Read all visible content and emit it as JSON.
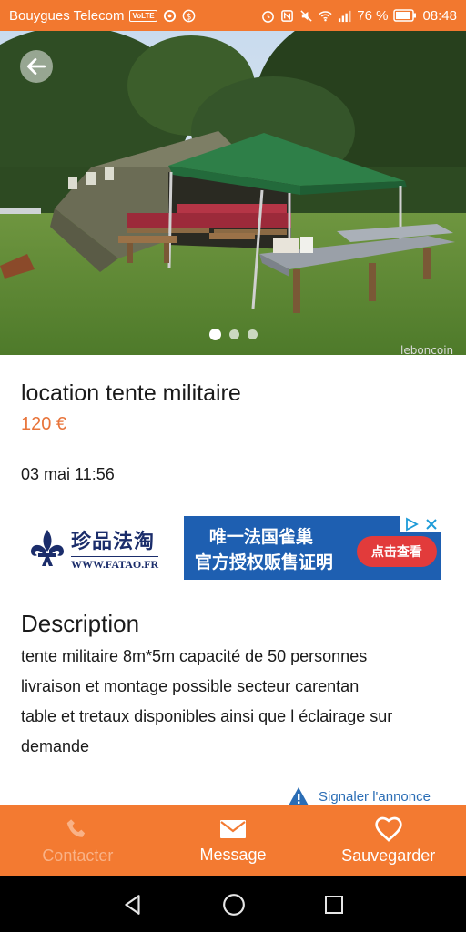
{
  "status_bar": {
    "carrier": "Bouygues Telecom",
    "volte": "VoLTE",
    "battery": "76 %",
    "time": "08:48"
  },
  "gallery": {
    "image_count": 3,
    "active_index": 0
  },
  "listing": {
    "title": "location tente militaire",
    "price": "120 €",
    "date": "03 mai 11:56"
  },
  "ad": {
    "brand_cn": "珍品法淘",
    "brand_url": "WWW.FATAO.FR",
    "line1": "唯一法国雀巢",
    "line2": "官方授权贩售证明",
    "cta": "点击查看"
  },
  "description": {
    "heading": "Description",
    "lines": [
      "tente militaire 8m*5m capacité de 50 personnes",
      "livraison et montage possible secteur carentan",
      "table et tretaux disponibles ainsi que l éclairage sur",
      "demande"
    ]
  },
  "report_link": "Signaler l'annonce",
  "actions": {
    "contact": "Contacter",
    "message": "Message",
    "save": "Sauvegarder"
  },
  "colors": {
    "accent": "#f37a31",
    "price": "#e8743a",
    "link": "#2a6db5"
  }
}
